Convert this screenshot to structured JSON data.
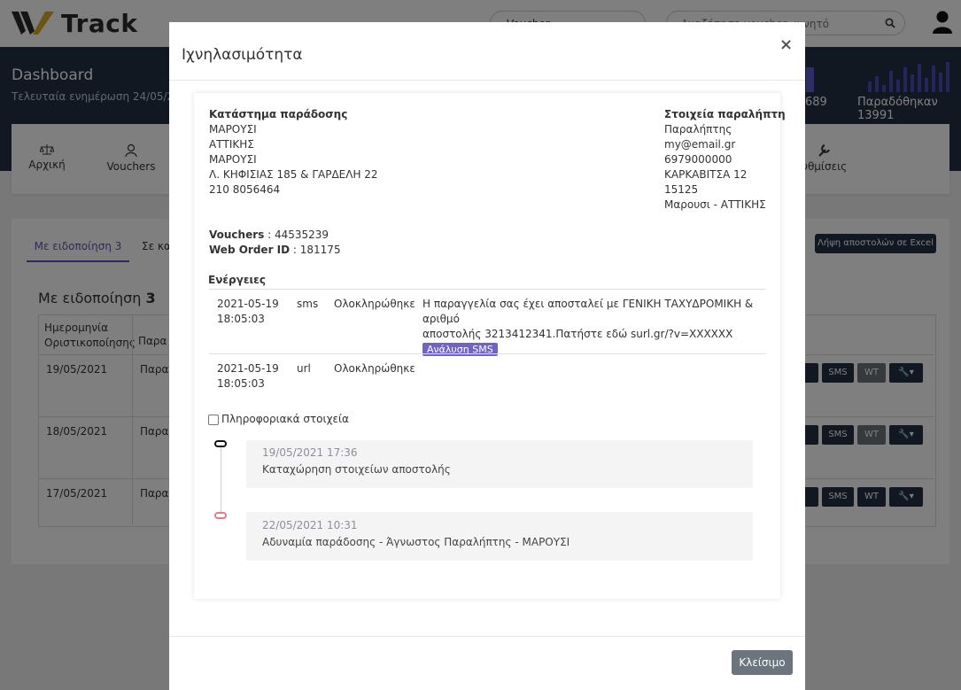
{
  "app": {
    "brand": "Track"
  },
  "topbar": {
    "select_value": "Voucher",
    "search_placeholder": "Αναζήτηση voucher, κινητό"
  },
  "header": {
    "title": "Dashboard",
    "subtitle": "Τελευταία ενημέρωση 24/05/202",
    "stat_left": "689",
    "stat_right": "Παραδόθηκαν 13991"
  },
  "nav": {
    "items": [
      {
        "label": "Αρχική",
        "icon": "scale-icon"
      },
      {
        "label": "Vouchers",
        "icon": "user-icon"
      },
      {
        "label": "υθμίσεις",
        "icon": "wrench-icon"
      }
    ]
  },
  "content": {
    "tab_active": "Με ειδοποίηση 3",
    "tab_second": "Σε κα",
    "excel_button": "Λήψη αποστολών σε Excel",
    "section_title_prefix": "Με ειδοποίηση",
    "section_title_count": "3",
    "table_header": {
      "col1_line1": "Ημερομηνία",
      "col1_line2": "Οριστικοποίησης",
      "col2": "Παρα"
    },
    "rows": [
      {
        "date": "19/05/2021",
        "col2": "Παρα",
        "sms": "SMS",
        "wt": "WT"
      },
      {
        "date": "18/05/2021",
        "col2": "Παρα",
        "sms": "SMS",
        "wt": "WT"
      },
      {
        "date": "17/05/2021",
        "col2": "Παρα",
        "sms": "SMS",
        "wt": "WT"
      }
    ]
  },
  "modal": {
    "title": "Ιχνηλασιμότητα",
    "close_x": "×",
    "store": {
      "heading": "Κατάστημα παράδοσης",
      "lines": [
        "ΜΑΡΟΥΣΙ",
        "ΑΤΤΙΚΗΣ",
        "ΜΑΡΟΥΣΙ",
        "Λ. ΚΗΦΙΣΙΑΣ 185 & ΓΑΡΔΕΛΗ 22",
        "210 8056464"
      ]
    },
    "recipient": {
      "heading": "Στοιχεία παραλήπτη",
      "lines": [
        "Παραλήπτης",
        "my@email.gr",
        "6979000000",
        "ΚΑΡΚΑΒΙΤΣΑ 12",
        "15125",
        "Μαρουσι - ΑΤΤΙΚΗΣ"
      ]
    },
    "vouchers_label": "Vouchers",
    "vouchers_value": " : 44535239",
    "order_label": "Web Order ID",
    "order_value": " : 181175",
    "actions_heading": "Ενέργειες",
    "actions": [
      {
        "date": "2021-05-19",
        "time": "18:05:03",
        "type": "sms",
        "status": "Ολοκληρώθηκε",
        "message_line1": "Η παραγγελία σας έχει αποσταλεί με ΓΕΝΙΚΗ ΤΑΧΥΔΡΟΜΙΚΗ & αριθμό",
        "message_line2": "αποστολής 3213412341.Πατήστε εδώ surl.gr/?v=XXXXXX",
        "badge": "Ανάλυση SMS"
      },
      {
        "date": "2021-05-19",
        "time": "18:05:03",
        "type": "url",
        "status": "Ολοκληρώθηκε"
      }
    ],
    "info_checkbox_label": "Πληροφοριακά στοιχεία",
    "timeline": [
      {
        "date": "19/05/2021 17:36",
        "text": "Καταχώρηση στοιχείων αποστολής"
      },
      {
        "date": "22/05/2021 10:31",
        "text": "Αδυναμία παράδοσης - Άγνωστος Παραλήπτης - ΜΑΡΟΥΣΙ"
      }
    ],
    "close_button": "Κλείσιμο"
  },
  "colors": {
    "dark_header": "#253044",
    "accent": "#5a55b5",
    "badge": "#6f63c5",
    "close_button": "#6c757d"
  }
}
